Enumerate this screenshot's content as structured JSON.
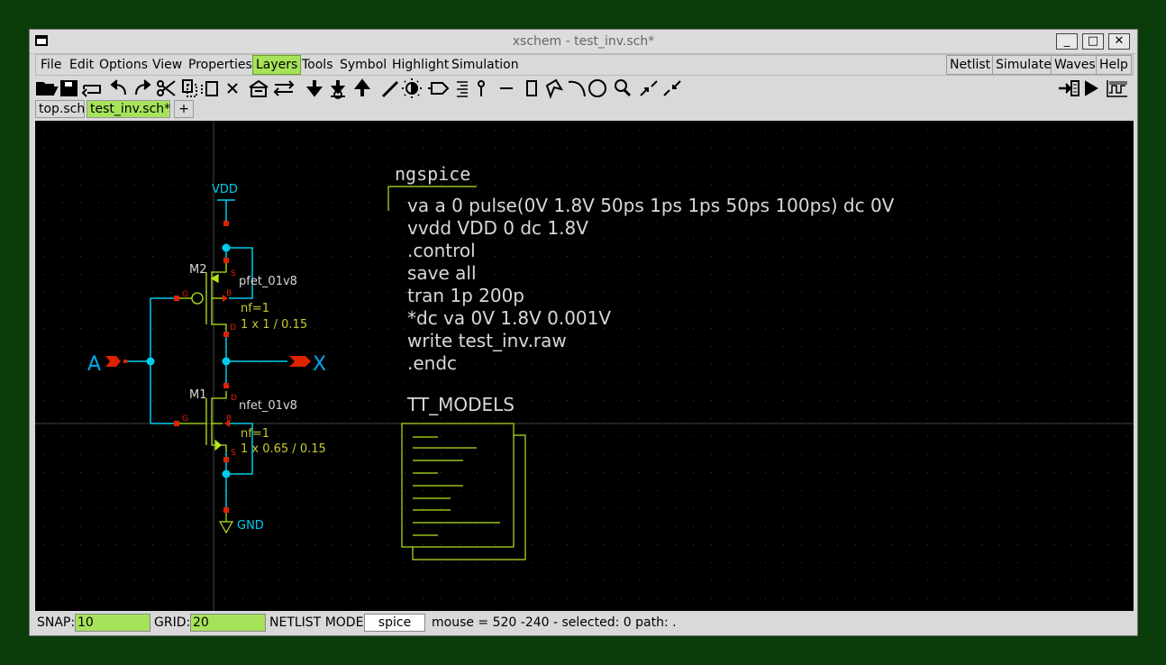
{
  "window": {
    "title": "xschem - test_inv.sch*"
  },
  "window_controls": {
    "minimize": "_",
    "maximize": "□",
    "close": "✕"
  },
  "menu": {
    "left": [
      "File",
      "Edit",
      "Options",
      "View",
      "Properties",
      "Layers",
      "Tools",
      "Symbol",
      "Highlight",
      "Simulation"
    ],
    "active": "Layers",
    "right": [
      "Netlist",
      "Simulate",
      "Waves",
      "Help"
    ]
  },
  "toolbar_icons": [
    "open-icon",
    "save-icon",
    "reload-icon",
    "undo-icon",
    "redo-icon",
    "cut-icon",
    "copy-icon",
    "paste-icon",
    "delete-icon",
    "place-symbol-icon",
    "move-icon",
    "push-down-icon",
    "descend-icon",
    "pop-up-icon",
    "wire-icon",
    "highlight-icon",
    "net-label-icon",
    "pin-icon",
    "probe-icon",
    "line-icon",
    "rectangle-icon",
    "polygon-icon",
    "arc-icon",
    "circle-icon",
    "zoom-icon",
    "zoom-in-icon",
    "zoom-out-icon",
    "insert-icon",
    "run-icon",
    "waveform-icon"
  ],
  "tabs": [
    {
      "label": "top.sch",
      "active": false
    },
    {
      "label": "test_inv.sch*",
      "active": true
    }
  ],
  "tab_add": "+",
  "schematic": {
    "vdd_label": "VDD",
    "gnd_label": "GND",
    "input_label": "A",
    "output_label": "X",
    "m2": {
      "name": "M2",
      "model": "pfet_01v8",
      "nf": "nf=1",
      "size": "1 x 1 / 0.15",
      "pin_s": "S",
      "pin_g": "G",
      "pin_b": "B",
      "pin_d": "D"
    },
    "m1": {
      "name": "M1",
      "model": "nfet_01v8",
      "nf": "nf=1",
      "size": "1 x 0.65 / 0.15",
      "pin_s": "S",
      "pin_g": "G",
      "pin_b": "B",
      "pin_d": "D"
    },
    "code_title": "ngspice",
    "code_lines": [
      "va a 0 pulse(0V 1.8V 50ps 1ps 1ps 50ps 100ps) dc 0V",
      "vvdd VDD 0 dc 1.8V",
      ".control",
      "save all",
      "tran 1p 200p",
      "*dc va 0V 1.8V 0.001V",
      "write test_inv.raw",
      ".endc"
    ],
    "models_title": "TT_MODELS"
  },
  "colors": {
    "wire": "#00ccee",
    "symbol": "#b5e61d",
    "pin": "#dd2200",
    "text": "#d8d8d8",
    "attr": "#c8c832",
    "accent_green": "#a6e35a"
  },
  "status": {
    "snap_label": "SNAP:",
    "snap_value": "10",
    "grid_label": "GRID:",
    "grid_value": "20",
    "netlist_mode_label": "NETLIST MODE:",
    "netlist_mode_value": "spice",
    "info": "mouse = 520 -240 - selected: 0 path: ."
  }
}
